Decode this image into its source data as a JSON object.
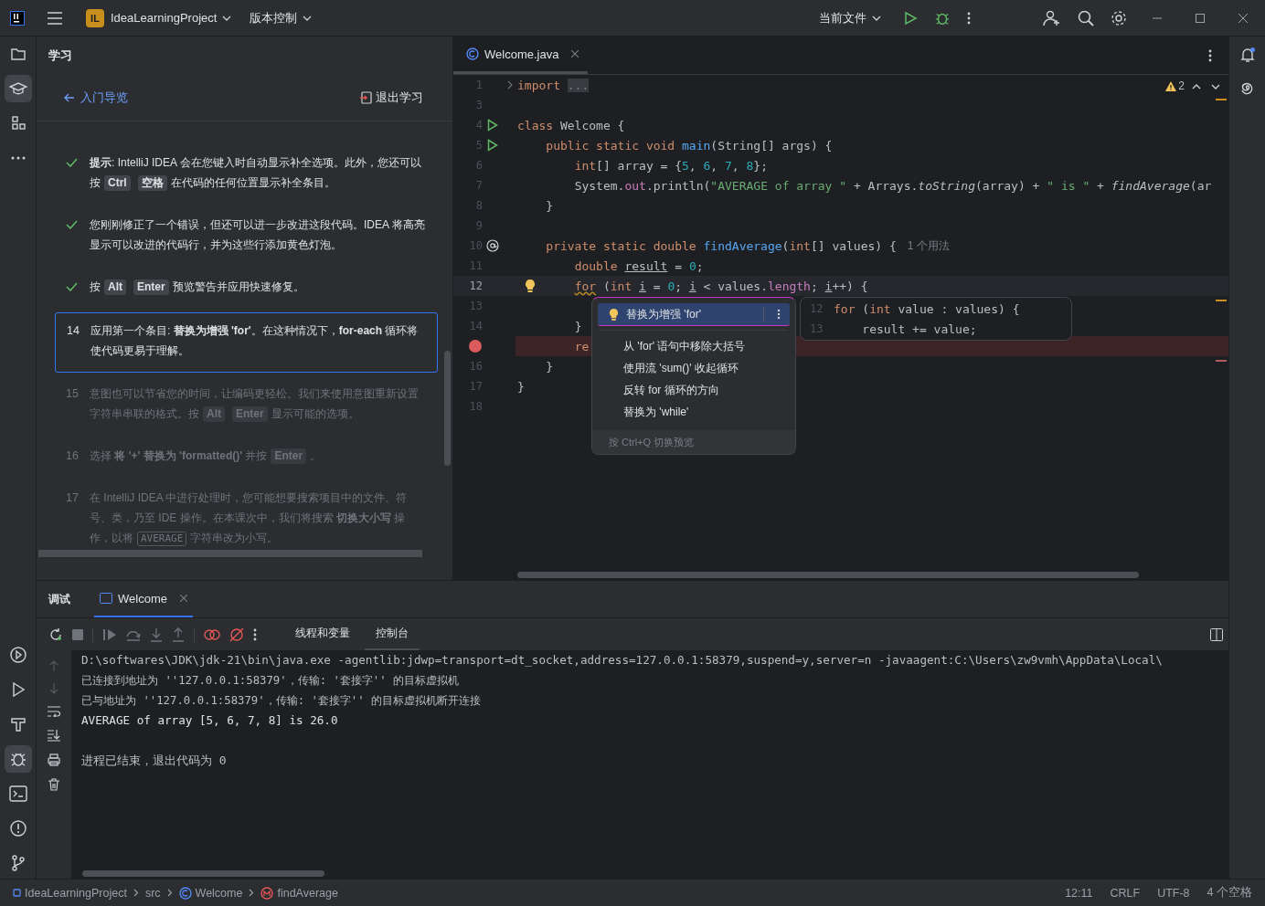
{
  "title_bar": {
    "project_badge": "IL",
    "project": "IdeaLearningProject",
    "vcs": "版本控制",
    "run_config": "当前文件"
  },
  "left_toolbar": {
    "top": [
      {
        "kind": "project",
        "selected": false
      },
      {
        "kind": "learn",
        "selected": true
      },
      {
        "kind": "structure",
        "selected": false
      },
      {
        "kind": "more",
        "selected": false
      }
    ],
    "bottom": [
      {
        "kind": "services",
        "selected": false
      },
      {
        "kind": "run",
        "selected": false
      },
      {
        "kind": "build",
        "selected": false
      },
      {
        "kind": "debug",
        "selected": true
      },
      {
        "kind": "terminal",
        "selected": false
      },
      {
        "kind": "problems",
        "selected": false
      },
      {
        "kind": "git",
        "selected": false
      }
    ]
  },
  "learn_panel": {
    "title": "学习",
    "back_link": "入门导览",
    "exit_button": "退出学习",
    "steps": [
      {
        "kind": "done",
        "parts": [
          {
            "kind": "text",
            "text": "**提示**: IntelliJ IDEA 会在您键入时自动显示补全选项。此外，您还可以按"
          },
          {
            "kind": "key",
            "text": "Ctrl"
          },
          {
            "kind": "key",
            "text": "空格"
          },
          {
            "kind": "text",
            "text": "在代码的任何位置显示补全条目。"
          }
        ]
      },
      {
        "kind": "done",
        "parts": [
          {
            "kind": "text",
            "text": "您刚刚修正了一个错误，但还可以进一步改进这段代码。IDEA 将高亮显示可以改进的代码行，并为这些行添加黄色灯泡。"
          }
        ]
      },
      {
        "kind": "done",
        "parts": [
          {
            "kind": "text",
            "text": "按"
          },
          {
            "kind": "key",
            "text": "Alt"
          },
          {
            "kind": "key",
            "text": "Enter"
          },
          {
            "kind": "text",
            "text": "预览警告并应用快速修复。"
          }
        ]
      },
      {
        "kind": "current",
        "number": "14",
        "parts": [
          {
            "kind": "text",
            "text": "应用第一个条目: **替换为增强 'for'**。在这种情况下，**for-each** 循环将使代码更易于理解。"
          }
        ]
      },
      {
        "kind": "future",
        "number": "15",
        "parts": [
          {
            "kind": "text",
            "text": "意图也可以节省您的时间，让编码更轻松。我们来使用意图重新设置字符串串联的格式。按"
          },
          {
            "kind": "key",
            "text": "Alt"
          },
          {
            "kind": "key",
            "text": "Enter"
          },
          {
            "kind": "text",
            "text": "显示可能的选项。"
          }
        ]
      },
      {
        "kind": "future",
        "number": "16",
        "parts": [
          {
            "kind": "text",
            "text": "选择 **将 '+' 替换为 'formatted()'** 并按"
          },
          {
            "kind": "key",
            "text": "Enter"
          },
          {
            "kind": "text",
            "text": "。"
          }
        ]
      },
      {
        "kind": "future",
        "number": "17",
        "parts": [
          {
            "kind": "text",
            "text": "在 IntelliJ IDEA 中进行处理时，您可能想要搜索项目中的文件、符号、类，乃至 IDE 操作。在本课次中，我们将搜索 **切换大小写** 操作，以将"
          },
          {
            "kind": "code",
            "text": "AVERAGE"
          },
          {
            "kind": "text",
            "text": "字符串改为小写。"
          }
        ]
      }
    ]
  },
  "editor": {
    "tab": "Welcome.java",
    "warnings": "2",
    "lines": [
      {
        "number": "1",
        "kind": "fold",
        "current": false,
        "tokens": [
          {
            "kind": "kw",
            "text": "import "
          },
          {
            "kind": "fold",
            "text": "..."
          }
        ]
      },
      {
        "number": "3",
        "kind": "plain",
        "current": false
      },
      {
        "number": "4",
        "kind": "run",
        "current": false,
        "tokens": [
          {
            "kind": "kw",
            "text": "class"
          },
          {
            "kind": "plain",
            "text": " Welcome {"
          }
        ]
      },
      {
        "number": "5",
        "kind": "run",
        "current": false,
        "tokens": [
          {
            "kind": "kw",
            "text": "    public static void "
          },
          {
            "kind": "decl",
            "text": "main"
          },
          {
            "kind": "plain",
            "text": "(String[] args) {"
          }
        ]
      },
      {
        "number": "6",
        "kind": "plain",
        "current": false,
        "tokens": [
          {
            "kind": "kw",
            "text": "        int"
          },
          {
            "kind": "plain",
            "text": "[] array = {"
          },
          {
            "kind": "num",
            "text": "5"
          },
          {
            "kind": "plain",
            "text": ", "
          },
          {
            "kind": "num",
            "text": "6"
          },
          {
            "kind": "plain",
            "text": ", "
          },
          {
            "kind": "num",
            "text": "7"
          },
          {
            "kind": "plain",
            "text": ", "
          },
          {
            "kind": "num",
            "text": "8"
          },
          {
            "kind": "plain",
            "text": "};"
          }
        ]
      },
      {
        "number": "7",
        "kind": "plain",
        "current": false,
        "tokens": [
          {
            "kind": "plain",
            "text": "        System."
          },
          {
            "kind": "field",
            "text": "out"
          },
          {
            "kind": "plain",
            "text": ".println("
          },
          {
            "kind": "str",
            "text": "\"AVERAGE of array \""
          },
          {
            "kind": "plain",
            "text": " + Arrays."
          },
          {
            "kind": "static",
            "text": "toString"
          },
          {
            "kind": "plain",
            "text": "(array) + "
          },
          {
            "kind": "str",
            "text": "\" is \""
          },
          {
            "kind": "plain",
            "text": " + "
          },
          {
            "kind": "static",
            "text": "findAverage"
          },
          {
            "kind": "plain",
            "text": "(ar"
          }
        ]
      },
      {
        "number": "8",
        "kind": "plain",
        "current": false,
        "tokens": [
          {
            "kind": "plain",
            "text": "    }"
          }
        ]
      },
      {
        "number": "9",
        "kind": "plain",
        "current": false
      },
      {
        "number": "10",
        "kind": "override",
        "current": false,
        "hint": "1 个用法",
        "tokens": [
          {
            "kind": "kw",
            "text": "    private static double "
          },
          {
            "kind": "decl",
            "text": "findAverage"
          },
          {
            "kind": "plain",
            "text": "("
          },
          {
            "kind": "kw",
            "text": "int"
          },
          {
            "kind": "plain",
            "text": "[] values) {"
          }
        ]
      },
      {
        "number": "11",
        "kind": "plain",
        "current": false,
        "tokens": [
          {
            "kind": "kw",
            "text": "        double "
          },
          {
            "kind": "var",
            "text": "result"
          },
          {
            "kind": "plain",
            "text": " = "
          },
          {
            "kind": "num",
            "text": "0"
          },
          {
            "kind": "plain",
            "text": ";"
          }
        ]
      },
      {
        "number": "12",
        "kind": "bulb",
        "current": true,
        "tokens": [
          {
            "kind": "warn",
            "text": "        for"
          },
          {
            "kind": "plain",
            "text": " ("
          },
          {
            "kind": "kw",
            "text": "int "
          },
          {
            "kind": "var",
            "text": "i"
          },
          {
            "kind": "plain",
            "text": " = "
          },
          {
            "kind": "num",
            "text": "0"
          },
          {
            "kind": "plain",
            "text": "; "
          },
          {
            "kind": "var",
            "text": "i"
          },
          {
            "kind": "plain",
            "text": " < values."
          },
          {
            "kind": "field",
            "text": "length"
          },
          {
            "kind": "plain",
            "text": "; "
          },
          {
            "kind": "var",
            "text": "i"
          },
          {
            "kind": "plain",
            "text": "++) {"
          }
        ]
      },
      {
        "number": "13",
        "kind": "plain",
        "current": false
      },
      {
        "number": "14",
        "kind": "plain",
        "current": false,
        "tokens": [
          {
            "kind": "plain",
            "text": "        }"
          }
        ]
      },
      {
        "kind": "breakpoint",
        "current": false,
        "tokens": [
          {
            "kind": "kw",
            "text": "        re"
          }
        ]
      },
      {
        "number": "16",
        "kind": "plain",
        "current": false,
        "tokens": [
          {
            "kind": "plain",
            "text": "    }"
          }
        ]
      },
      {
        "number": "17",
        "kind": "plain",
        "current": false,
        "tokens": [
          {
            "kind": "plain",
            "text": "}"
          }
        ]
      },
      {
        "number": "18",
        "kind": "plain",
        "current": false
      }
    ],
    "intention_menu": {
      "items": [
        {
          "label": "替换为增强 'for'",
          "selected": true
        },
        {
          "label": "从 'for' 语句中移除大括号",
          "selected": false
        },
        {
          "label": "使用流 'sum()' 收起循环",
          "selected": false
        },
        {
          "label": "反转 for 循环的方向",
          "selected": false
        },
        {
          "label": "替换为 'while'",
          "selected": false
        }
      ],
      "footer": "按 Ctrl+Q 切换预览"
    },
    "preview": {
      "lines": [
        {
          "number": "12",
          "tokens": [
            {
              "kind": "kw",
              "text": "for"
            },
            {
              "kind": "plain",
              "text": " ("
            },
            {
              "kind": "kw",
              "text": "int"
            },
            {
              "kind": "plain",
              "text": " value : values) {"
            }
          ]
        },
        {
          "number": "13",
          "tokens": [
            {
              "kind": "plain",
              "text": "    result += value;"
            }
          ]
        }
      ]
    }
  },
  "debug_panel": {
    "title": "调试",
    "session_tab": {
      "label": "Welcome",
      "selected": true
    },
    "tabs": [
      {
        "label": "线程和变量",
        "selected": false
      },
      {
        "label": "控制台",
        "selected": true
      }
    ],
    "console": [
      {
        "kind": "command",
        "text": "D:\\softwares\\JDK\\jdk-21\\bin\\java.exe -agentlib:jdwp=transport=dt_socket,address=127.0.0.1:58379,suspend=y,server=n -javaagent:C:\\Users\\zw9vmh\\AppData\\Local\\"
      },
      {
        "kind": "system",
        "text": "已连接到地址为 ''127.0.0.1:58379'，传输: '套接字'' 的目标虚拟机"
      },
      {
        "kind": "system",
        "text": "已与地址为 ''127.0.0.1:58379'，传输: '套接字'' 的目标虚拟机断开连接"
      },
      {
        "kind": "output",
        "text": "AVERAGE of array [5, 6, 7, 8] is 26.0"
      },
      {
        "kind": "exit",
        "text": "进程已结束，退出代码为 0"
      }
    ]
  },
  "status_bar": {
    "breadcrumbs": [
      {
        "kind": "module",
        "text": "IdeaLearningProject"
      },
      {
        "kind": "folder",
        "text": "src"
      },
      {
        "kind": "class",
        "text": "Welcome"
      },
      {
        "kind": "method",
        "text": "findAverage"
      }
    ],
    "items": [
      "12:11",
      "CRLF",
      "UTF-8",
      "4 个空格"
    ]
  }
}
